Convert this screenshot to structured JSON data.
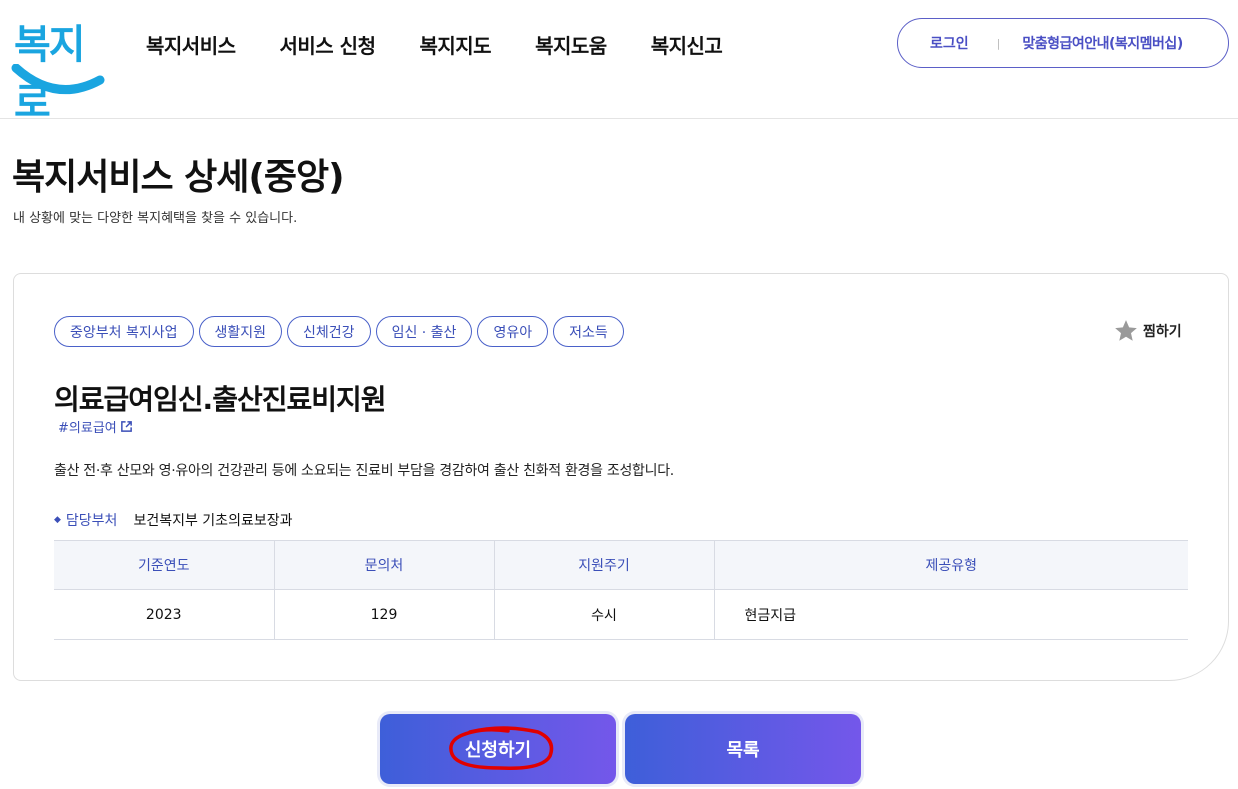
{
  "header": {
    "logo": "복지로",
    "nav": [
      "복지서비스",
      "서비스 신청",
      "복지지도",
      "복지도움",
      "복지신고"
    ],
    "util": {
      "login": "로그인",
      "member": "맞춤형급여안내(복지멤버십)"
    }
  },
  "page": {
    "title": "복지서비스 상세(중앙)",
    "subtitle": "내 상황에 맞는 다양한 복지혜택을 찾을 수 있습니다."
  },
  "service": {
    "tags": [
      "중앙부처 복지사업",
      "생활지원",
      "신체건강",
      "임신 · 출산",
      "영유아",
      "저소득"
    ],
    "favorite": "찜하기",
    "title": "의료급여임신.출산진료비지원",
    "hashtag": "#의료급여",
    "description": "출산 전·후 산모와 영·유아의 건강관리 등에 소요되는 진료비 부담을 경감하여 출산 친화적 환경을 조성합니다.",
    "dept_label": "담당부처",
    "dept_value": "보건복지부 기초의료보장과",
    "table": {
      "headers": [
        "기준연도",
        "문의처",
        "지원주기",
        "제공유형"
      ],
      "row": [
        "2023",
        "129",
        "수시",
        "현금지급"
      ]
    }
  },
  "buttons": {
    "apply": "신청하기",
    "list": "목록"
  },
  "colors": {
    "brand": "#3b4fb8",
    "logo": "#1aa5e0",
    "button_start": "#3e5fd9",
    "button_end": "#7457ea",
    "annotation": "#e00000"
  }
}
